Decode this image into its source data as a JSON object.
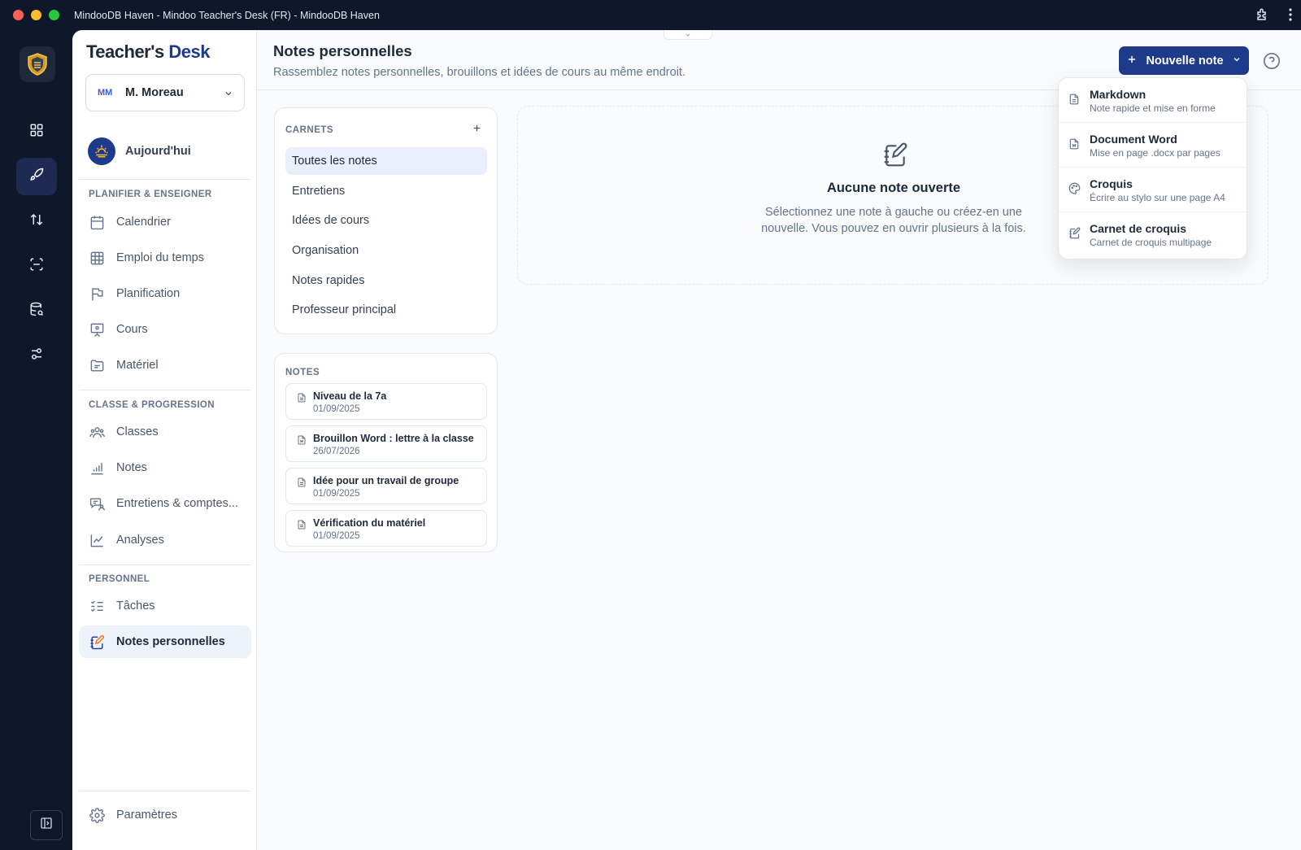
{
  "window": {
    "title": "MindooDB Haven - Mindoo Teacher's Desk (FR) - MindooDB Haven"
  },
  "brand": {
    "part1": "Teacher's",
    "part2": "Desk"
  },
  "user": {
    "initials": "MM",
    "name": "M. Moreau"
  },
  "today": {
    "label": "Aujourd'hui"
  },
  "sections": {
    "plan": "PLANIFIER & ENSEIGNER",
    "classe": "CLASSE & PROGRESSION",
    "perso": "PERSONNEL"
  },
  "nav": {
    "calendrier": "Calendrier",
    "emploi": "Emploi du temps",
    "planification": "Planification",
    "cours": "Cours",
    "materiel": "Matériel",
    "classes": "Classes",
    "notes": "Notes",
    "entretiens": "Entretiens & comptes...",
    "analyses": "Analyses",
    "taches": "Tâches",
    "notes_perso": "Notes personnelles",
    "parametres": "Paramètres"
  },
  "page": {
    "title": "Notes personnelles",
    "subtitle": "Rassemblez notes personnelles, brouillons et idées de cours au même endroit.",
    "new_note_label": "Nouvelle note"
  },
  "notebooks": {
    "title": "CARNETS",
    "items": [
      "Toutes les notes",
      "Entretiens",
      "Idées de cours",
      "Organisation",
      "Notes rapides",
      "Professeur principal"
    ]
  },
  "notes": {
    "title": "NOTES",
    "items": [
      {
        "title": "Niveau de la 7a",
        "date": "01/09/2025"
      },
      {
        "title": "Brouillon Word : lettre à la classe",
        "date": "26/07/2026"
      },
      {
        "title": "Idée pour un travail de groupe",
        "date": "01/09/2025"
      },
      {
        "title": "Vérification du matériel",
        "date": "01/09/2025"
      }
    ]
  },
  "empty": {
    "title": "Aucune note ouverte",
    "text": "Sélectionnez une note à gauche ou créez-en une nouvelle. Vous pouvez en ouvrir plusieurs à la fois."
  },
  "dropdown": {
    "items": [
      {
        "title": "Markdown",
        "subtitle": "Note rapide et mise en forme",
        "icon": "file-text-icon"
      },
      {
        "title": "Document Word",
        "subtitle": "Mise en page .docx par pages",
        "icon": "file-word-icon"
      },
      {
        "title": "Croquis",
        "subtitle": "Écrire au stylo sur une page A4",
        "icon": "palette-icon"
      },
      {
        "title": "Carnet de croquis",
        "subtitle": "Carnet de croquis multipage",
        "icon": "notebook-pen-icon"
      }
    ]
  },
  "colors": {
    "accent": "#1e3a8a",
    "rail": "#0f172a",
    "active_bg": "#eef2fb"
  }
}
